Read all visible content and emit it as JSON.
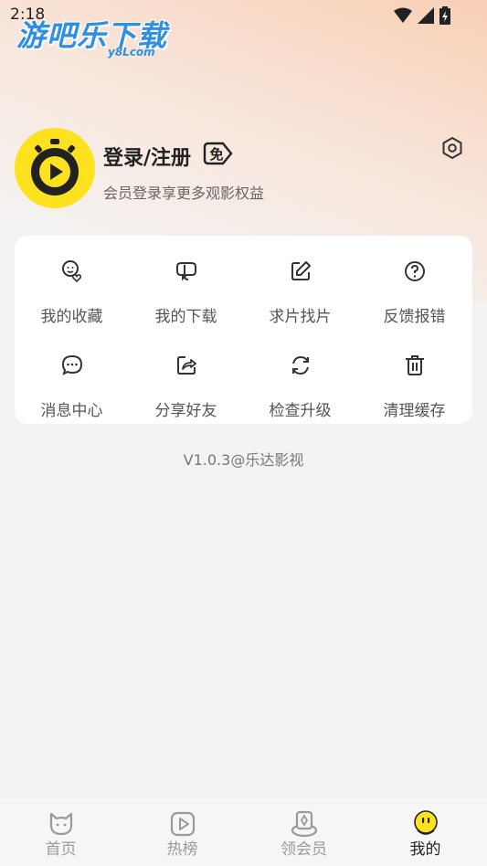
{
  "status_bar": {
    "time": "2:18"
  },
  "watermark": {
    "main": "游吧乐下载",
    "sub": "y8Lcom"
  },
  "user": {
    "name": "登录/注册",
    "badge": "免",
    "subtitle": "会员登录享更多观影权益"
  },
  "grid": [
    {
      "label": "我的收藏",
      "icon": "favorite-icon"
    },
    {
      "label": "我的下载",
      "icon": "download-icon"
    },
    {
      "label": "求片找片",
      "icon": "edit-icon"
    },
    {
      "label": "反馈报错",
      "icon": "help-icon"
    },
    {
      "label": "消息中心",
      "icon": "message-icon"
    },
    {
      "label": "分享好友",
      "icon": "share-icon"
    },
    {
      "label": "检查升级",
      "icon": "refresh-icon"
    },
    {
      "label": "清理缓存",
      "icon": "trash-icon"
    }
  ],
  "version": "V1.0.3@乐达影视",
  "tabs": [
    {
      "label": "首页",
      "icon": "home-icon"
    },
    {
      "label": "热榜",
      "icon": "play-icon"
    },
    {
      "label": "领会员",
      "icon": "vip-icon"
    },
    {
      "label": "我的",
      "icon": "profile-icon",
      "active": true
    }
  ],
  "colors": {
    "accent": "#ffe21f",
    "brand_blue": "#2e8fe3"
  }
}
